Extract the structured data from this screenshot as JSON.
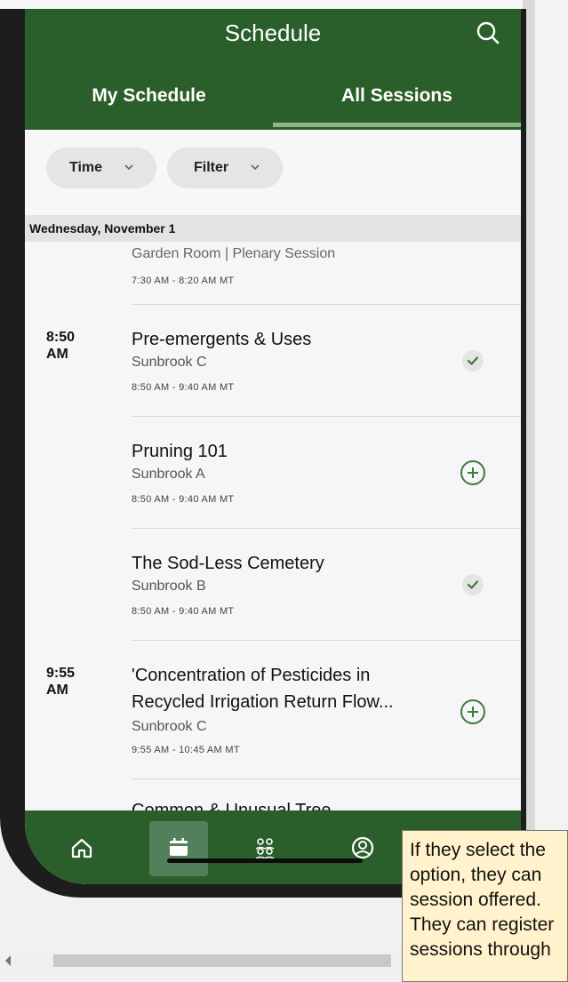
{
  "header": {
    "title": "Schedule",
    "tabs": [
      {
        "label": "My Schedule",
        "active": false
      },
      {
        "label": "All Sessions",
        "active": true
      }
    ]
  },
  "filters": [
    {
      "label": "Time"
    },
    {
      "label": "Filter"
    }
  ],
  "date_header": "Wednesday, November 1",
  "sessions": [
    {
      "time": "",
      "title": "",
      "room": "Garden Room | Plenary Session",
      "range": "7:30 AM - 8:20 AM MT",
      "status": "none"
    },
    {
      "time_line1": "8:50",
      "time_line2": "AM",
      "title": "Pre-emergents & Uses",
      "room": "Sunbrook C",
      "range": "8:50 AM - 9:40 AM MT",
      "status": "added"
    },
    {
      "time_line1": "",
      "time_line2": "",
      "title": "Pruning 101",
      "room": "Sunbrook A",
      "range": "8:50 AM - 9:40 AM MT",
      "status": "add"
    },
    {
      "time_line1": "",
      "time_line2": "",
      "title": "The Sod-Less Cemetery",
      "room": "Sunbrook B",
      "range": "8:50 AM - 9:40 AM MT",
      "status": "added"
    },
    {
      "time_line1": "9:55",
      "time_line2": "AM",
      "title_line1": "'Concentration of Pesticides in",
      "title_line2": "Recycled Irrigation Return Flow...",
      "room": "Sunbrook C",
      "range": "9:55 AM - 10:45 AM MT",
      "status": "add"
    },
    {
      "time_line1": "",
      "time_line2": "",
      "title": "Common & Unusual Tree",
      "status": "none"
    }
  ],
  "bottom_nav": [
    {
      "icon": "home-icon",
      "active": false
    },
    {
      "icon": "calendar-icon",
      "active": true
    },
    {
      "icon": "people-icon",
      "active": false
    },
    {
      "icon": "profile-icon",
      "active": false
    }
  ],
  "callout": {
    "lines": [
      "If they select the",
      "option, they can",
      "session offered.",
      "They can register",
      "sessions through"
    ]
  },
  "colors": {
    "brand_green": "#2a5f2b",
    "accent_green": "#3c7a3e",
    "callout_bg": "#fff2cc"
  }
}
